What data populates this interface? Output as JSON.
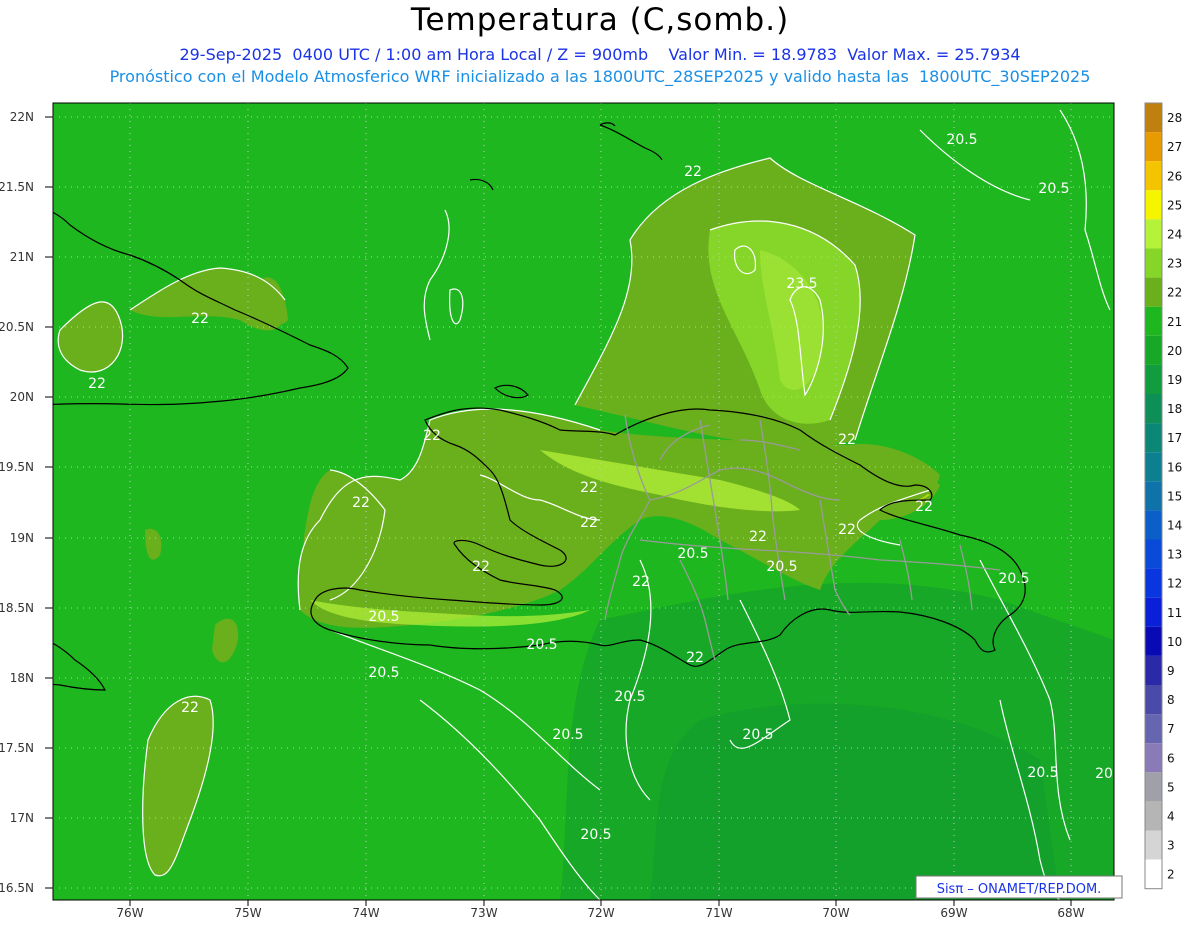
{
  "header": {
    "title": "Temperatura (C,somb.)",
    "line1": "29-Sep-2025  0400 UTC / 1:00 am Hora Local / Z = 900mb    Valor Min. = 18.9783  Valor Max. = 25.7934",
    "line2": "Pronóstico con el Modelo Atmosferico WRF inicializado a las 1800UTC_28SEP2025 y valido hasta las  1800UTC_30SEP2025"
  },
  "map": {
    "lat_labels": [
      "22N",
      "21.5N",
      "21N",
      "20.5N",
      "20N",
      "19.5N",
      "19N",
      "18.5N",
      "18N",
      "17.5N",
      "17N",
      "16.5N"
    ],
    "lon_labels": [
      "76W",
      "75W",
      "74W",
      "73W",
      "72W",
      "71W",
      "70W",
      "69W",
      "68W"
    ],
    "contour_labels": [
      {
        "text": "22"
      },
      {
        "text": "22"
      },
      {
        "text": "22"
      },
      {
        "text": "22"
      },
      {
        "text": "22"
      },
      {
        "text": "22"
      },
      {
        "text": "22"
      },
      {
        "text": "22"
      },
      {
        "text": "22"
      },
      {
        "text": "22"
      },
      {
        "text": "22"
      },
      {
        "text": "22"
      },
      {
        "text": "22"
      },
      {
        "text": "22"
      },
      {
        "text": "23.5"
      },
      {
        "text": "20.5"
      },
      {
        "text": "20.5"
      },
      {
        "text": "20.5"
      },
      {
        "text": "20.5"
      },
      {
        "text": "20.5"
      },
      {
        "text": "20.5"
      },
      {
        "text": "20.5"
      },
      {
        "text": "20.5"
      },
      {
        "text": "20.5"
      },
      {
        "text": "20.5"
      },
      {
        "text": "20.5"
      },
      {
        "text": "20.5"
      },
      {
        "text": "20.5"
      },
      {
        "text": "20"
      }
    ],
    "credit": "Sisπ – ONAMET/REP.DOM."
  },
  "colorbar": {
    "labels": [
      "28",
      "27",
      "26",
      "25",
      "24",
      "23",
      "22",
      "21",
      "20",
      "19",
      "18",
      "17",
      "16",
      "15",
      "14",
      "13",
      "12",
      "11",
      "10",
      "9",
      "8",
      "7",
      "6",
      "5",
      "4",
      "3",
      "2"
    ],
    "colors": [
      "#c0800f",
      "#e89b00",
      "#f5c400",
      "#f5f500",
      "#b5f23a",
      "#86d629",
      "#6aaf1c",
      "#1fb71f",
      "#16a826",
      "#119c3d",
      "#0f8f58",
      "#0c8675",
      "#0c7f90",
      "#0f73aa",
      "#0a5fc8",
      "#0a4ad8",
      "#0a36e0",
      "#0a1fd8",
      "#0a0ab5",
      "#2a2aa8",
      "#4a4aa8",
      "#6565b0",
      "#8a7ab8",
      "#a0a0a8",
      "#b5b5b5",
      "#d5d5d5",
      "#ffffff"
    ]
  }
}
